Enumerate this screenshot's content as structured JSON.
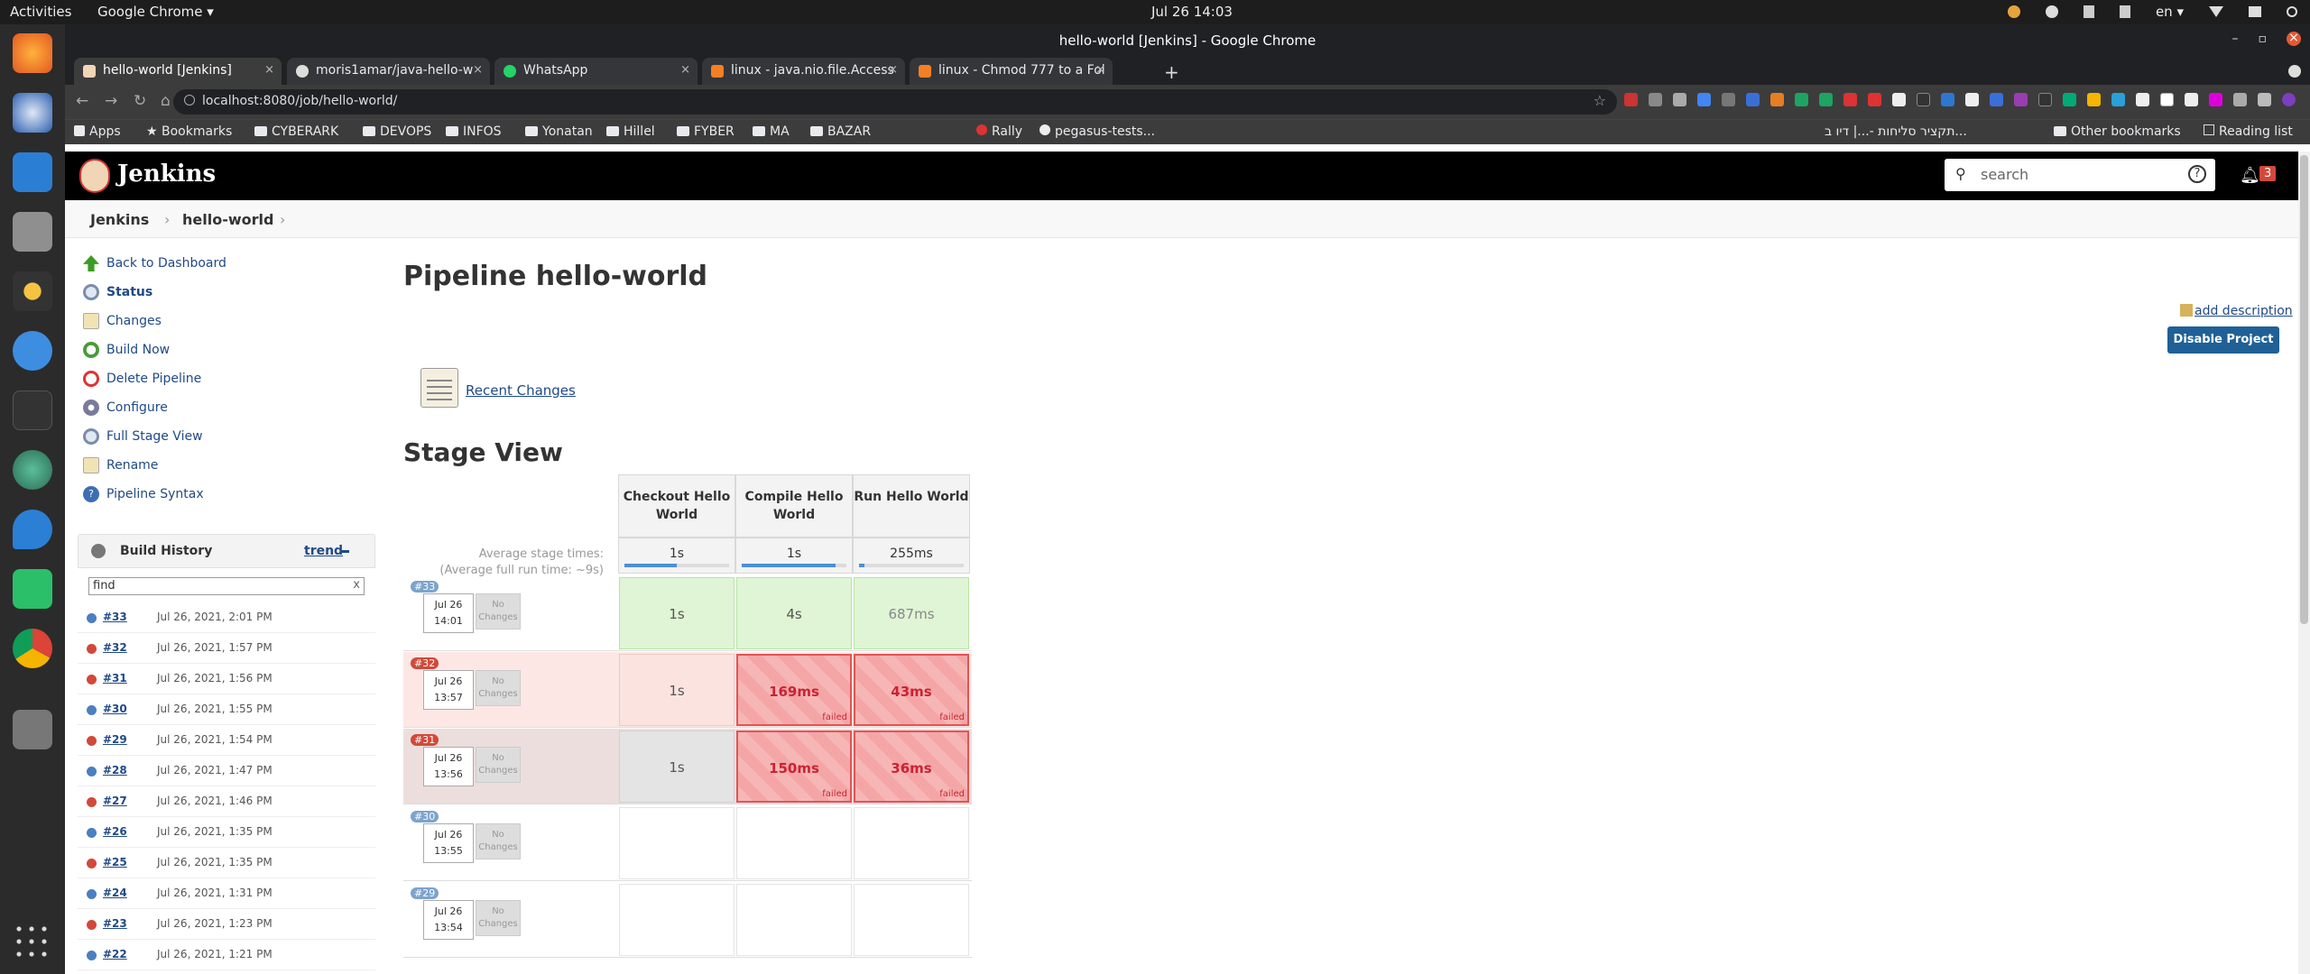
{
  "os": {
    "activities": "Activities",
    "app_menu": "Google Chrome ▾",
    "clock": "Jul 26  14:03",
    "lang": "en ▾"
  },
  "chrome": {
    "window_title": "hello-world [Jenkins] - Google Chrome",
    "tabs": [
      {
        "label": "hello-world [Jenkins]",
        "active": true
      },
      {
        "label": "moris1amar/java-hello-w"
      },
      {
        "label": "WhatsApp"
      },
      {
        "label": "linux - java.nio.file.Access"
      },
      {
        "label": "linux - Chmod 777 to a Fol"
      }
    ],
    "url": "localhost:8080/job/hello-world/",
    "bookmarks": [
      "Apps",
      "Bookmarks",
      "CYBERARK",
      "DEVOPS",
      "INFOS",
      "Yonatan",
      "Hillel",
      "FYBER",
      "MA",
      "BAZAR",
      "Rally",
      "pegasus-tests...",
      "תקציר סליחות -...| דיו ב...",
      "Other bookmarks",
      "Reading list"
    ]
  },
  "jenkins": {
    "brand": "Jenkins",
    "search_placeholder": "search",
    "help": "?",
    "notifications": "3",
    "breadcrumbs": [
      "Jenkins",
      "hello-world"
    ],
    "tasks": [
      {
        "label": "Back to Dashboard",
        "icon": "arrow-up-icon"
      },
      {
        "label": "Status",
        "icon": "magnifier-icon"
      },
      {
        "label": "Changes",
        "icon": "notepad-icon"
      },
      {
        "label": "Build Now",
        "icon": "clock-play-icon"
      },
      {
        "label": "Delete Pipeline",
        "icon": "no-entry-icon"
      },
      {
        "label": "Configure",
        "icon": "gear-icon"
      },
      {
        "label": "Full Stage View",
        "icon": "magnifier-icon"
      },
      {
        "label": "Rename",
        "icon": "notepad-icon"
      },
      {
        "label": "Pipeline Syntax",
        "icon": "help-icon"
      }
    ],
    "build_history": {
      "title": "Build History",
      "trend": "trend",
      "find_placeholder": "find",
      "clear": "x",
      "builds": [
        {
          "num": "#33",
          "date": "Jul 26, 2021, 2:01 PM",
          "status": "success"
        },
        {
          "num": "#32",
          "date": "Jul 26, 2021, 1:57 PM",
          "status": "failed"
        },
        {
          "num": "#31",
          "date": "Jul 26, 2021, 1:56 PM",
          "status": "failed"
        },
        {
          "num": "#30",
          "date": "Jul 26, 2021, 1:55 PM",
          "status": "success"
        },
        {
          "num": "#29",
          "date": "Jul 26, 2021, 1:54 PM",
          "status": "failed"
        },
        {
          "num": "#28",
          "date": "Jul 26, 2021, 1:47 PM",
          "status": "success"
        },
        {
          "num": "#27",
          "date": "Jul 26, 2021, 1:46 PM",
          "status": "failed"
        },
        {
          "num": "#26",
          "date": "Jul 26, 2021, 1:35 PM",
          "status": "success"
        },
        {
          "num": "#25",
          "date": "Jul 26, 2021, 1:35 PM",
          "status": "failed"
        },
        {
          "num": "#24",
          "date": "Jul 26, 2021, 1:31 PM",
          "status": "success"
        },
        {
          "num": "#23",
          "date": "Jul 26, 2021, 1:23 PM",
          "status": "failed"
        },
        {
          "num": "#22",
          "date": "Jul 26, 2021, 1:21 PM",
          "status": "success"
        }
      ]
    },
    "page_title": "Pipeline hello-world",
    "add_description": "add description",
    "disable_button": "Disable Project",
    "recent_changes": "Recent Changes",
    "stage_view": {
      "title": "Stage View",
      "avg_label_line1": "Average stage times:",
      "avg_label_line2": "(Average full run time: ~9s)",
      "stages": [
        {
          "name": "Checkout Hello World",
          "avg": "1s",
          "avg_fill": 0.5
        },
        {
          "name": "Compile Hello World",
          "avg": "1s",
          "avg_fill": 0.9
        },
        {
          "name": "Run Hello World",
          "avg": "255ms",
          "avg_fill": 0.05
        }
      ],
      "runs": [
        {
          "num": "#33",
          "date": "Jul 26",
          "time": "14:01",
          "changes": "No Changes",
          "status": "success",
          "cells": [
            {
              "v": "1s",
              "s": "ok"
            },
            {
              "v": "4s",
              "s": "ok"
            },
            {
              "v": "687ms",
              "s": "okdim"
            }
          ]
        },
        {
          "num": "#32",
          "date": "Jul 26",
          "time": "13:57",
          "changes": "No Changes",
          "status": "failed",
          "cells": [
            {
              "v": "1s",
              "s": "plainp2"
            },
            {
              "v": "169ms",
              "s": "fail"
            },
            {
              "v": "43ms",
              "s": "fail"
            }
          ]
        },
        {
          "num": "#31",
          "date": "Jul 26",
          "time": "13:56",
          "changes": "No Changes",
          "status": "failed",
          "cells": [
            {
              "v": "1s",
              "s": "plaing"
            },
            {
              "v": "150ms",
              "s": "fail"
            },
            {
              "v": "36ms",
              "s": "fail"
            }
          ]
        },
        {
          "num": "#30",
          "date": "Jul 26",
          "time": "13:55",
          "changes": "No Changes",
          "status": "success",
          "cells": [
            {
              "v": "",
              "s": "plain"
            },
            {
              "v": "",
              "s": "plain"
            },
            {
              "v": "",
              "s": "plain"
            }
          ]
        },
        {
          "num": "#29",
          "date": "Jul 26",
          "time": "13:54",
          "changes": "No Changes",
          "status": "success",
          "cells": [
            {
              "v": "",
              "s": "plain"
            },
            {
              "v": "",
              "s": "plain"
            },
            {
              "v": "",
              "s": "plain"
            }
          ]
        }
      ],
      "failed_label": "failed"
    },
    "colors": {
      "success": "#4a7fc1",
      "failed": "#d24939",
      "accent": "#1f6096"
    }
  }
}
